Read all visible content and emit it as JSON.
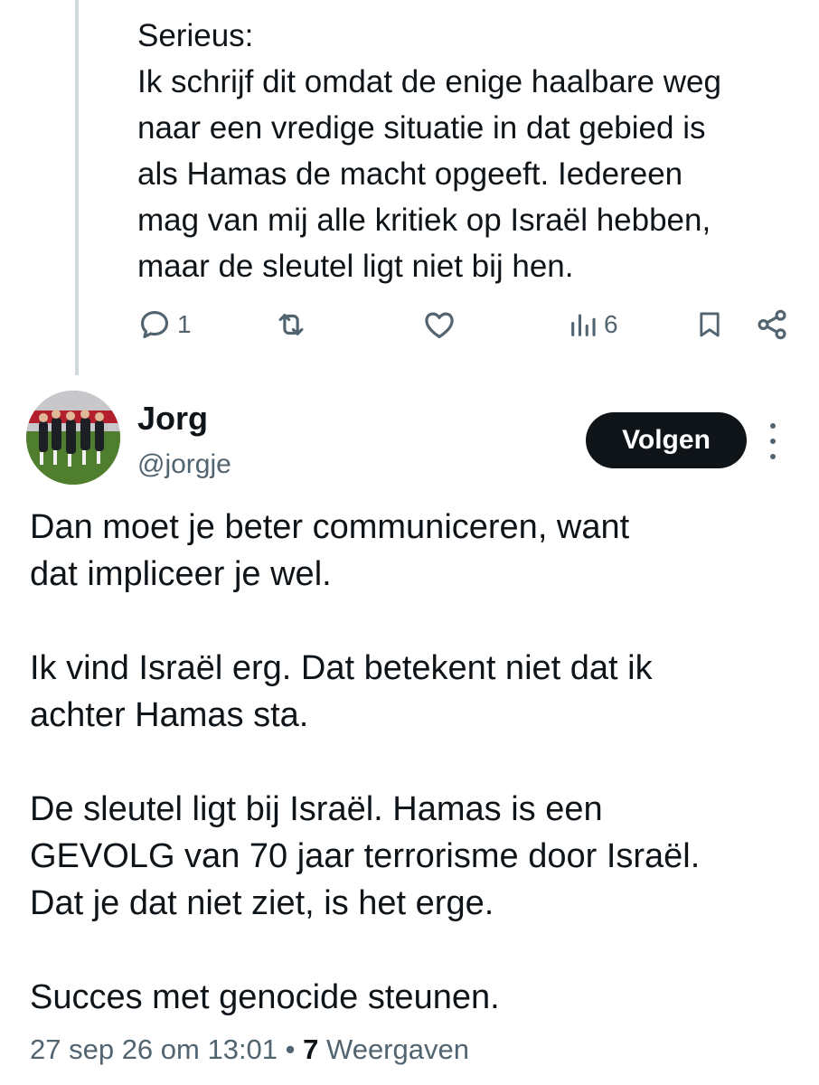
{
  "previous_tweet": {
    "text": "Serieus:\nIk schrijf dit omdat de enige haalbare weg\nnaar een vredige situatie in dat gebied is\nals Hamas de macht opgeeft. Iedereen\nmag van mij alle kritiek op Israël hebben,\nmaar de sleutel ligt niet bij hen.",
    "actions": {
      "reply_icon": "reply-icon",
      "reply_count": "1",
      "retweet_icon": "retweet-icon",
      "like_icon": "heart-icon",
      "views_icon": "bar-chart-icon",
      "views_count": "6",
      "bookmark_icon": "bookmark-icon",
      "share_icon": "share-icon"
    }
  },
  "reply": {
    "author": {
      "name": "Jorg",
      "handle": "@jorgje",
      "avatar": "avatar-photo"
    },
    "follow_label": "Volgen",
    "more_icon": "more-vertical-icon",
    "paragraphs": [
      "Dan moet je beter communiceren, want\ndat impliceer je wel.",
      "Ik vind Israël erg. Dat betekent niet dat ik\nachter Hamas sta.",
      "De sleutel ligt bij Israël. Hamas is een\nGEVOLG van 70 jaar terrorisme door Israël.\nDat je dat niet ziet, is het erge.",
      "Succes met genocide steunen."
    ],
    "timestamp": "27 sep 26 om 13:01",
    "separator": " • ",
    "views_count": "7",
    "views_label": " Weergaven"
  },
  "colors": {
    "text": "#0f1419",
    "secondary": "#536471",
    "thread_line": "#cfd9de",
    "button_bg": "#0f1419"
  }
}
